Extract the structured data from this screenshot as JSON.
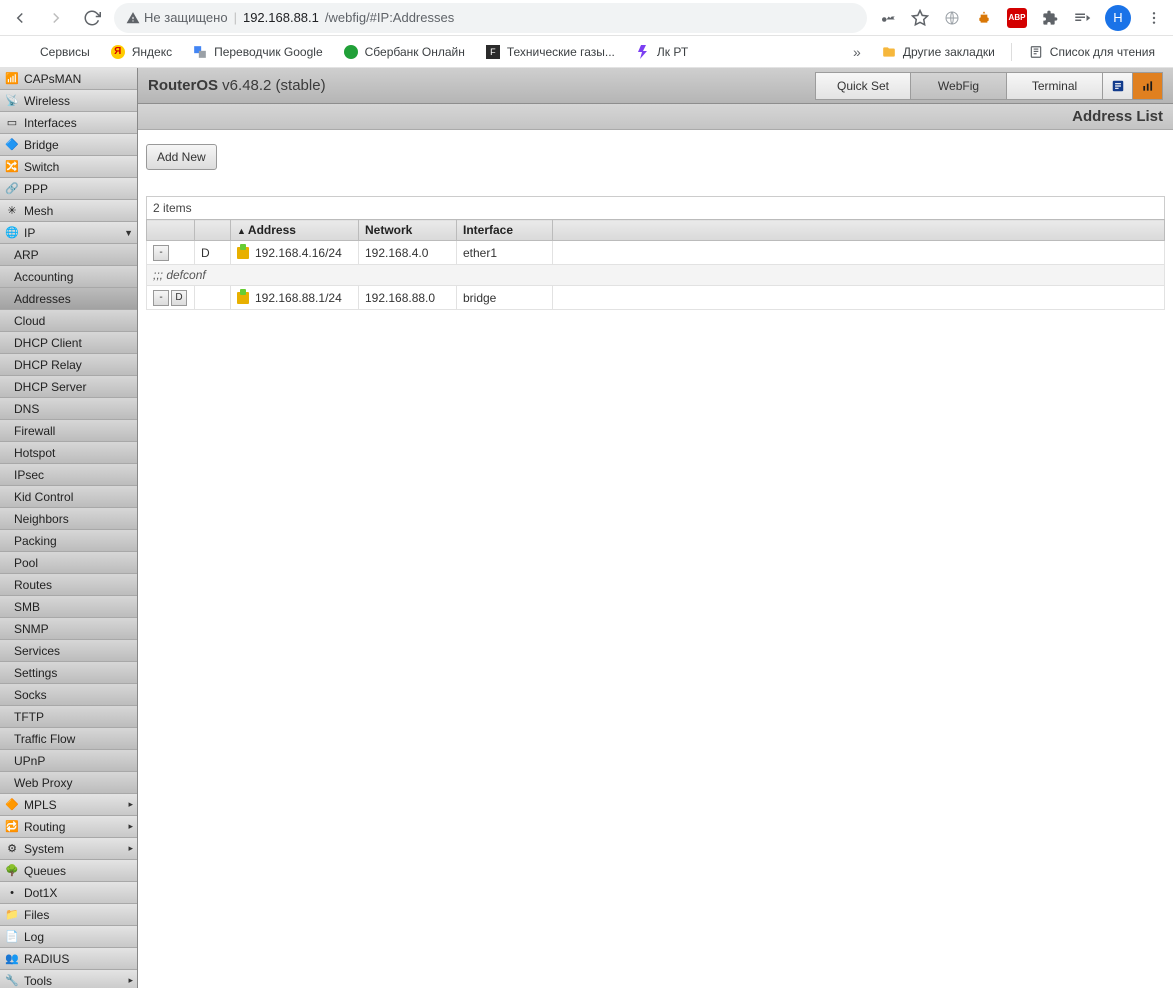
{
  "browser": {
    "not_secure_label": "Не защищено",
    "url_host": "192.168.88.1",
    "url_path": "/webfig/#IP:Addresses",
    "avatar_letter": "Н",
    "abp_label": "ABP",
    "bookmarks": {
      "apps": "Сервисы",
      "yandex": "Яндекс",
      "gtranslate": "Переводчик Google",
      "sber": "Сбербанк Онлайн",
      "techgas": "Технические газы...",
      "lkrt": "Лк РТ",
      "more": "»",
      "other": "Другие закладки",
      "reading": "Список для чтения"
    }
  },
  "sidebar": {
    "items": [
      {
        "label": "CAPsMAN",
        "arrow": ""
      },
      {
        "label": "Wireless",
        "arrow": ""
      },
      {
        "label": "Interfaces",
        "arrow": ""
      },
      {
        "label": "Bridge",
        "arrow": ""
      },
      {
        "label": "Switch",
        "arrow": ""
      },
      {
        "label": "PPP",
        "arrow": ""
      },
      {
        "label": "Mesh",
        "arrow": ""
      },
      {
        "label": "IP",
        "arrow": "▼"
      }
    ],
    "ip_sub": [
      "ARP",
      "Accounting",
      "Addresses",
      "Cloud",
      "DHCP Client",
      "DHCP Relay",
      "DHCP Server",
      "DNS",
      "Firewall",
      "Hotspot",
      "IPsec",
      "Kid Control",
      "Neighbors",
      "Packing",
      "Pool",
      "Routes",
      "SMB",
      "SNMP",
      "Services",
      "Settings",
      "Socks",
      "TFTP",
      "Traffic Flow",
      "UPnP",
      "Web Proxy"
    ],
    "ip_sub_active_index": 2,
    "items2": [
      {
        "label": "MPLS",
        "arrow": "▸"
      },
      {
        "label": "Routing",
        "arrow": "▸"
      },
      {
        "label": "System",
        "arrow": "▸"
      },
      {
        "label": "Queues",
        "arrow": ""
      },
      {
        "label": "Dot1X",
        "arrow": ""
      },
      {
        "label": "Files",
        "arrow": ""
      },
      {
        "label": "Log",
        "arrow": ""
      },
      {
        "label": "RADIUS",
        "arrow": ""
      },
      {
        "label": "Tools",
        "arrow": "▸"
      }
    ]
  },
  "topbar": {
    "brand_name": "RouterOS",
    "brand_ver": " v6.48.2 (stable)",
    "tabs": {
      "quickset": "Quick Set",
      "webfig": "WebFig",
      "terminal": "Terminal"
    },
    "active_tab": "webfig"
  },
  "subhead": "Address List",
  "content": {
    "add_btn": "Add New",
    "items_count": "2 items",
    "columns": {
      "c3": "Address",
      "c4": "Network",
      "c5": "Interface"
    },
    "rows": [
      {
        "minus": "-",
        "d": "",
        "flags": "D",
        "address": "192.168.4.16/24",
        "network": "192.168.4.0",
        "iface": "ether1"
      }
    ],
    "comment": ";;; defconf",
    "rows2": [
      {
        "minus": "-",
        "d": "D",
        "flags": "",
        "address": "192.168.88.1/24",
        "network": "192.168.88.0",
        "iface": "bridge"
      }
    ]
  }
}
